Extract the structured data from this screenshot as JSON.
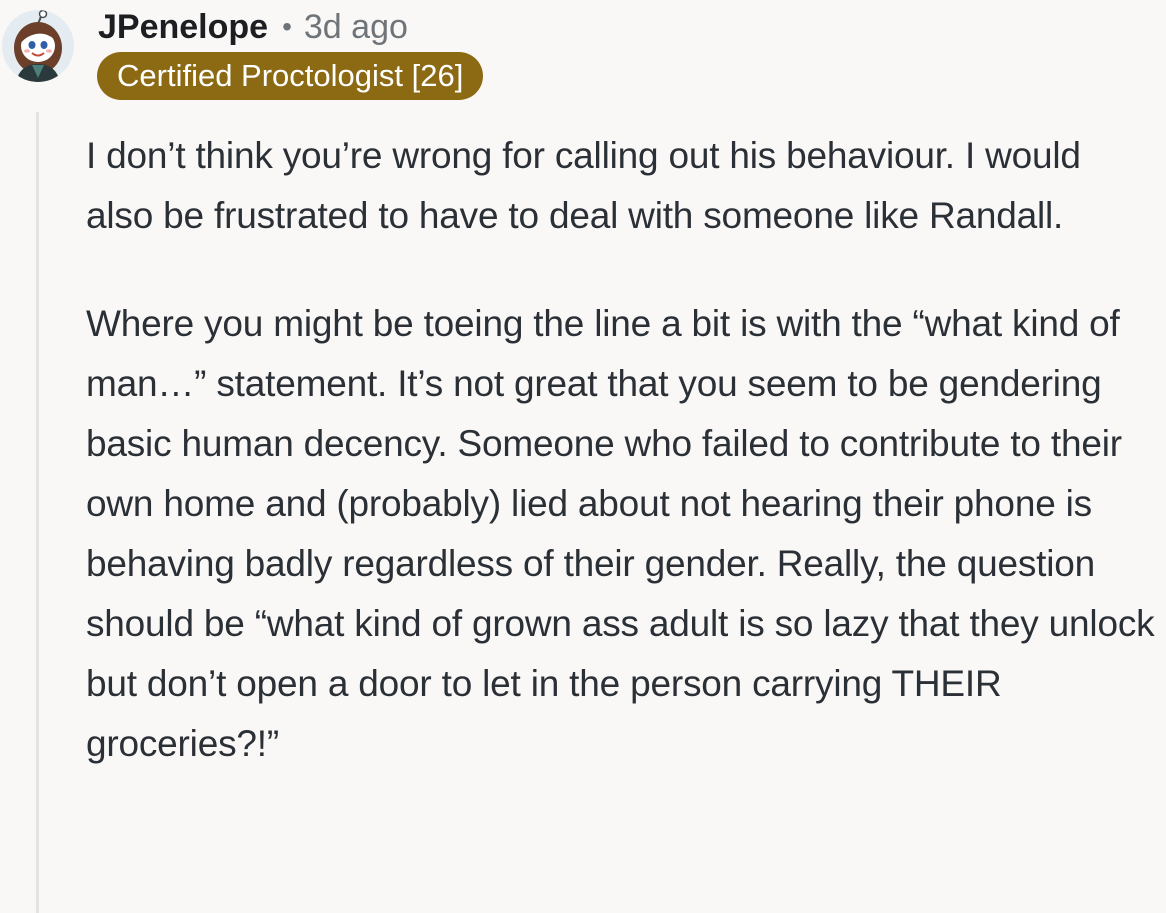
{
  "comment": {
    "avatar_icon": "snoo-avatar-icon",
    "username": "JPenelope",
    "separator": "•",
    "timestamp": "3d ago",
    "flair": {
      "text": "Certified Proctologist [26]",
      "color": "#8c6a14"
    },
    "paragraphs": [
      "I don’t think you’re wrong for calling out his behaviour. I would also be frustrated to have to deal with someone like Randall.",
      "Where you might be toeing the line a bit is with the “what kind of man…” statement. It’s not great that you seem to be gendering basic human decency. Someone who failed to contribute to their own home and (probably) lied about not hearing their phone is behaving badly regardless of their gender. Really, the question should be “what kind of grown ass adult is so lazy that they unlock but don’t open a door to let in the person carrying THEIR groceries?!”"
    ]
  },
  "colors": {
    "background": "#f9f8f7",
    "text": "#2b3036",
    "muted": "#6f7479",
    "thread_line": "#e5e2df"
  }
}
